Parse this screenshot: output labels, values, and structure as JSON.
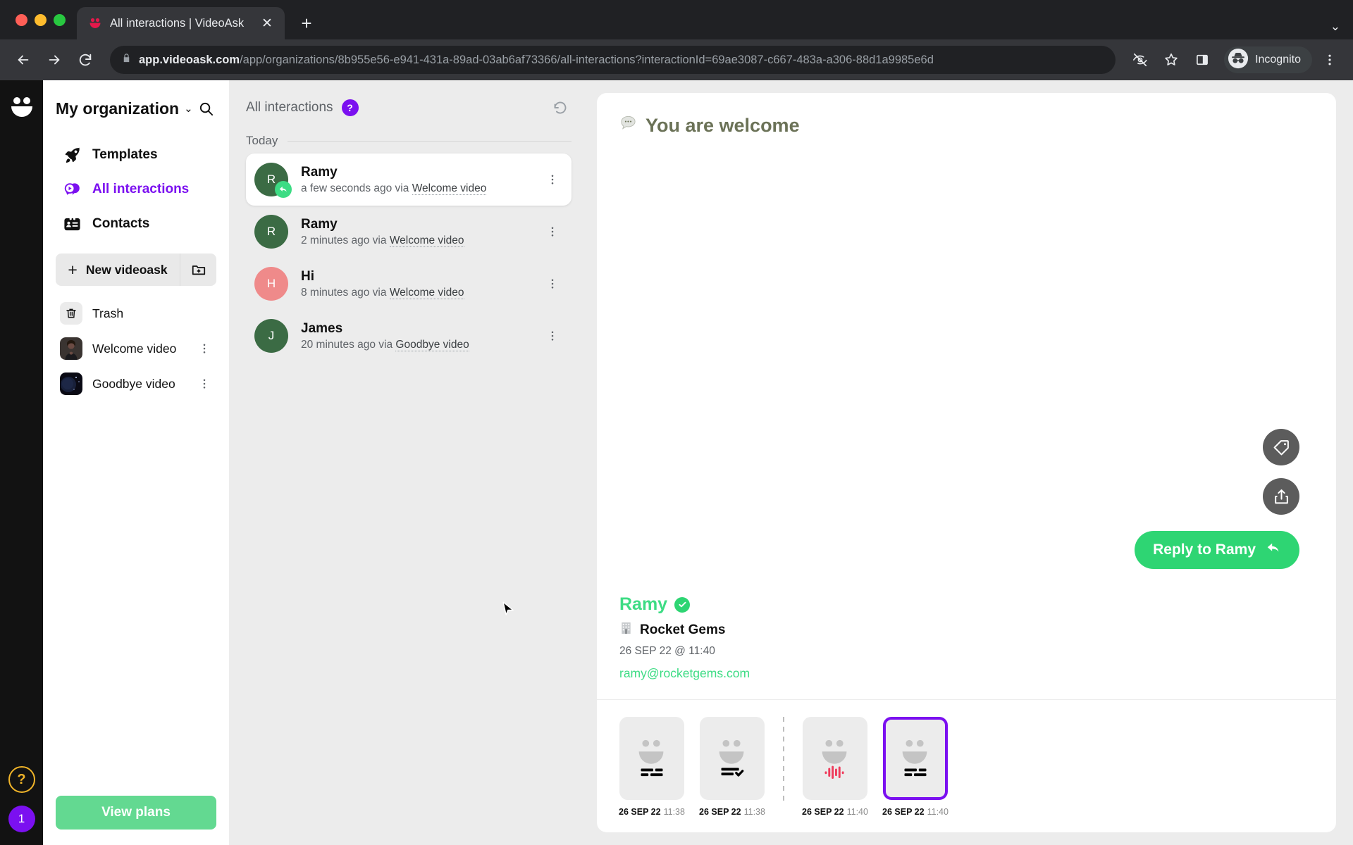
{
  "browser": {
    "tab": {
      "title": "All interactions | VideoAsk",
      "favicon_icon": "videoask-smiley-icon",
      "close_icon": "close-icon"
    },
    "new_tab_icon": "plus-icon",
    "tab_list_icon": "chevron-down-icon",
    "back_icon": "arrow-left-icon",
    "forward_icon": "arrow-right-icon",
    "reload_icon": "reload-icon",
    "lock_icon": "lock-icon",
    "url_host": "app.videoask.com",
    "url_path": "/app/organizations/8b955e56-e941-431a-89ad-03ab6af73366/all-interactions?interactionId=69ae3087-c667-483a-a306-88d1a9985e6d",
    "tracking_icon": "eye-slash-icon",
    "bookmark_icon": "star-icon",
    "sidepanel_icon": "side-panel-icon",
    "incognito_icon": "incognito-icon",
    "incognito_label": "Incognito",
    "menu_icon": "kebab-menu-icon"
  },
  "rail": {
    "logo_icon": "videoask-logo-icon",
    "help_icon": "question-mark-icon",
    "help_label": "?",
    "count_label": "1"
  },
  "sidebar": {
    "org_name": "My organization",
    "org_caret_icon": "chevron-down-icon",
    "search_icon": "search-icon",
    "nav": [
      {
        "label": "Templates",
        "icon": "rocket-icon",
        "active": false
      },
      {
        "label": "All interactions",
        "icon": "interactions-bubble-icon",
        "active": true
      },
      {
        "label": "Contacts",
        "icon": "contacts-card-icon",
        "active": false
      }
    ],
    "new_videoask_label": "New videoask",
    "new_plus_icon": "plus-icon",
    "new_folder_icon": "new-folder-icon",
    "items": [
      {
        "label": "Trash",
        "icon": "trash-icon",
        "has_menu": false
      },
      {
        "label": "Welcome video",
        "icon": "video-thumbnail-person",
        "has_menu": true
      },
      {
        "label": "Goodbye video",
        "icon": "video-thumbnail-night",
        "has_menu": true
      }
    ],
    "dots_icon": "kebab-menu-icon",
    "view_plans_label": "View plans"
  },
  "interactions": {
    "title": "All interactions",
    "help_badge_label": "?",
    "refresh_icon": "refresh-icon",
    "day_group_label": "Today",
    "conversations": [
      {
        "name": "Ramy",
        "initial": "R",
        "time_text": "a few seconds ago via",
        "via": "Welcome video",
        "avatar_color": "#3b6b44",
        "selected": true,
        "replied": true,
        "reply_icon": "reply-arrow-icon",
        "dots_icon": "kebab-menu-icon"
      },
      {
        "name": "Ramy",
        "initial": "R",
        "time_text": "2 minutes ago via",
        "via": "Welcome video",
        "avatar_color": "#3b6b44",
        "selected": false,
        "replied": false,
        "dots_icon": "kebab-menu-icon"
      },
      {
        "name": "Hi",
        "initial": "H",
        "time_text": "8 minutes ago via",
        "via": "Welcome video",
        "avatar_color": "#ef8a8a",
        "selected": false,
        "replied": false,
        "dots_icon": "kebab-menu-icon"
      },
      {
        "name": "James",
        "initial": "J",
        "time_text": "20 minutes ago via",
        "via": "Goodbye video",
        "avatar_color": "#3b6b44",
        "selected": false,
        "replied": false,
        "dots_icon": "kebab-menu-icon"
      }
    ]
  },
  "detail": {
    "title": "You are welcome",
    "title_icon": "speech-bubble-icon",
    "tag_icon": "tag-icon",
    "share_icon": "share-icon",
    "reply_button_label": "Reply to Ramy",
    "reply_button_icon": "reply-arrow-icon",
    "contact": {
      "name": "Ramy",
      "verified_icon": "verified-check-icon",
      "org_icon": "building-icon",
      "org": "Rocket Gems",
      "date": "26 SEP 22 @ 11:40",
      "email": "ramy@rocketgems.com"
    },
    "filmstrip": [
      {
        "date": "26 SEP 22",
        "time": "11:38",
        "icon": "text-lines-icon",
        "selected": false,
        "after_divider": false
      },
      {
        "date": "26 SEP 22",
        "time": "11:38",
        "icon": "text-answered-check-icon",
        "selected": false,
        "after_divider": false
      },
      {
        "date": "26 SEP 22",
        "time": "11:40",
        "icon": "audio-waveform-icon",
        "selected": false,
        "after_divider": true
      },
      {
        "date": "26 SEP 22",
        "time": "11:40",
        "icon": "text-lines-icon",
        "selected": true,
        "after_divider": true
      }
    ]
  },
  "colors": {
    "brand_purple": "#7b10f0",
    "brand_green": "#2ed573",
    "plans_green": "#63d991",
    "title_olive": "#6b7257",
    "waveform_red": "#ef3b5b"
  }
}
